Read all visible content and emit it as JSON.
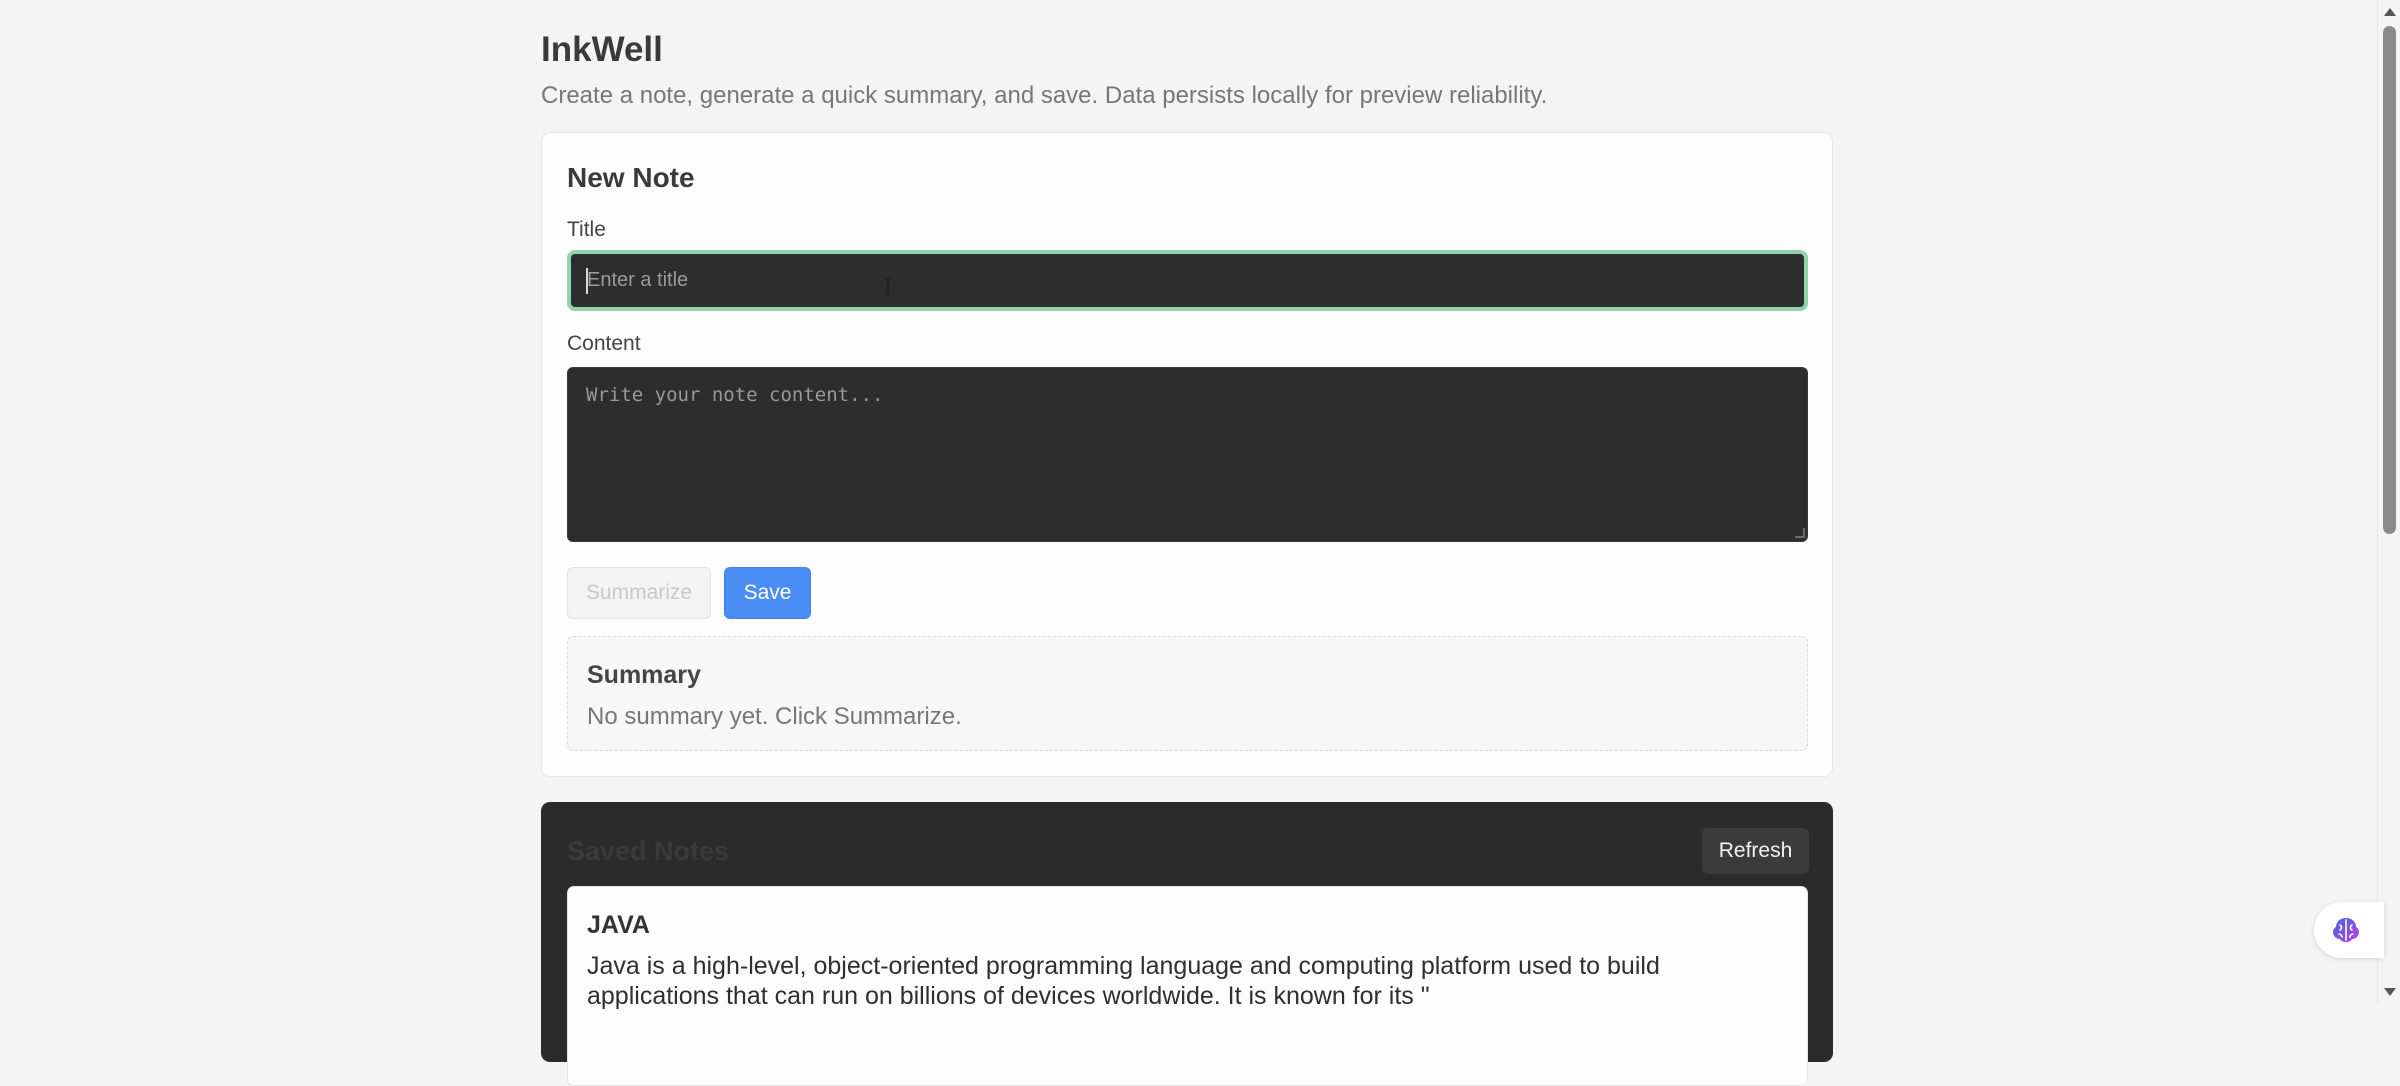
{
  "header": {
    "title": "InkWell",
    "subtitle": "Create a note, generate a quick summary, and save. Data persists locally for preview reliability."
  },
  "new_note": {
    "heading": "New Note",
    "title_label": "Title",
    "title_placeholder": "Enter a title",
    "title_value": "",
    "content_label": "Content",
    "content_placeholder": "Write your note content...",
    "content_value": "",
    "summarize_label": "Summarize",
    "save_label": "Save",
    "summary": {
      "heading": "Summary",
      "text": "No summary yet. Click Summarize."
    }
  },
  "saved_notes": {
    "heading": "Saved Notes",
    "refresh_label": "Refresh",
    "items": [
      {
        "title": "JAVA",
        "body": "Java is a high-level, object-oriented programming language and computing platform used to build applications that can run on billions of devices worldwide. It is known for its \""
      }
    ]
  },
  "icons": {
    "cursor": "text-cursor-icon",
    "assistant": "brain-icon"
  },
  "colors": {
    "accent_blue": "#4a8ef5",
    "focus_green": "#8fd3a8",
    "dark_field": "#2d2d2d"
  }
}
